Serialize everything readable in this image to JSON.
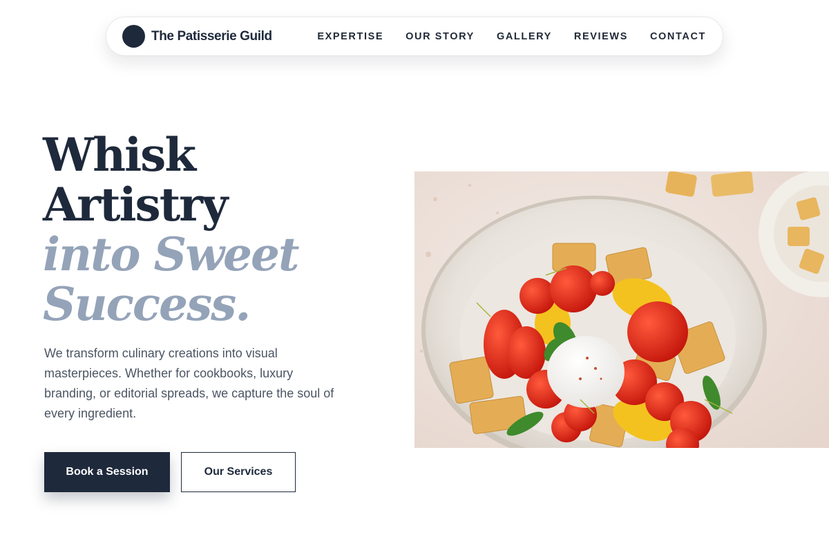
{
  "brand": {
    "name": "The Patisserie Guild"
  },
  "nav": {
    "items": [
      {
        "label": "EXPERTISE"
      },
      {
        "label": "OUR STORY"
      },
      {
        "label": "GALLERY"
      },
      {
        "label": "REVIEWS"
      },
      {
        "label": "CONTACT"
      }
    ]
  },
  "hero": {
    "headline_line1": "Whisk",
    "headline_line2": "Artistry",
    "headline_line3": "into Sweet",
    "headline_line4": "Success.",
    "description": "We transform culinary creations into visual masterpieces. Whether for cookbooks, luxury branding, or editorial spreads, we capture the soul of every ingredient.",
    "primary_cta": "Book a Session",
    "secondary_cta": "Our Services",
    "image_alt": "panzanella salad with tomatoes, burrata and croutons"
  },
  "colors": {
    "primary": "#1e293b",
    "muted_headline": "#94a3b8",
    "body_text": "#4b5563"
  }
}
